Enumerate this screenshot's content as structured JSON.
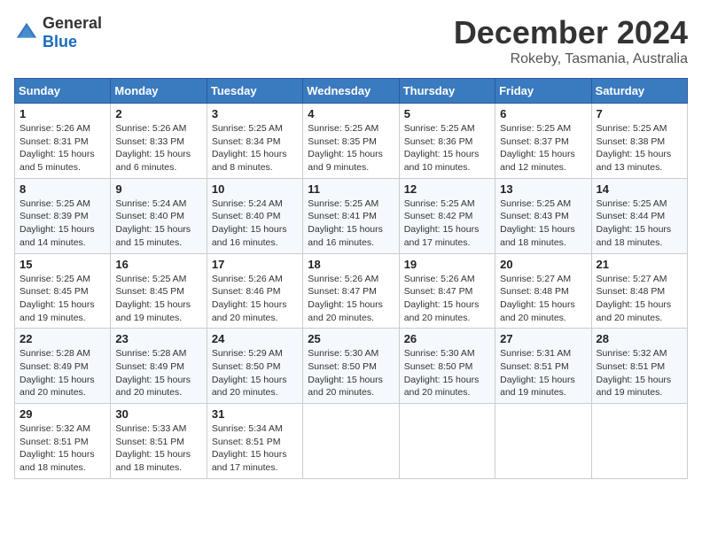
{
  "logo": {
    "general": "General",
    "blue": "Blue"
  },
  "title": {
    "month": "December 2024",
    "location": "Rokeby, Tasmania, Australia"
  },
  "calendar": {
    "headers": [
      "Sunday",
      "Monday",
      "Tuesday",
      "Wednesday",
      "Thursday",
      "Friday",
      "Saturday"
    ],
    "weeks": [
      [
        {
          "day": "1",
          "sunrise": "5:26 AM",
          "sunset": "8:31 PM",
          "daylight": "15 hours and 5 minutes."
        },
        {
          "day": "2",
          "sunrise": "5:26 AM",
          "sunset": "8:33 PM",
          "daylight": "15 hours and 6 minutes."
        },
        {
          "day": "3",
          "sunrise": "5:25 AM",
          "sunset": "8:34 PM",
          "daylight": "15 hours and 8 minutes."
        },
        {
          "day": "4",
          "sunrise": "5:25 AM",
          "sunset": "8:35 PM",
          "daylight": "15 hours and 9 minutes."
        },
        {
          "day": "5",
          "sunrise": "5:25 AM",
          "sunset": "8:36 PM",
          "daylight": "15 hours and 10 minutes."
        },
        {
          "day": "6",
          "sunrise": "5:25 AM",
          "sunset": "8:37 PM",
          "daylight": "15 hours and 12 minutes."
        },
        {
          "day": "7",
          "sunrise": "5:25 AM",
          "sunset": "8:38 PM",
          "daylight": "15 hours and 13 minutes."
        }
      ],
      [
        {
          "day": "8",
          "sunrise": "5:25 AM",
          "sunset": "8:39 PM",
          "daylight": "15 hours and 14 minutes."
        },
        {
          "day": "9",
          "sunrise": "5:24 AM",
          "sunset": "8:40 PM",
          "daylight": "15 hours and 15 minutes."
        },
        {
          "day": "10",
          "sunrise": "5:24 AM",
          "sunset": "8:40 PM",
          "daylight": "15 hours and 16 minutes."
        },
        {
          "day": "11",
          "sunrise": "5:25 AM",
          "sunset": "8:41 PM",
          "daylight": "15 hours and 16 minutes."
        },
        {
          "day": "12",
          "sunrise": "5:25 AM",
          "sunset": "8:42 PM",
          "daylight": "15 hours and 17 minutes."
        },
        {
          "day": "13",
          "sunrise": "5:25 AM",
          "sunset": "8:43 PM",
          "daylight": "15 hours and 18 minutes."
        },
        {
          "day": "14",
          "sunrise": "5:25 AM",
          "sunset": "8:44 PM",
          "daylight": "15 hours and 18 minutes."
        }
      ],
      [
        {
          "day": "15",
          "sunrise": "5:25 AM",
          "sunset": "8:45 PM",
          "daylight": "15 hours and 19 minutes."
        },
        {
          "day": "16",
          "sunrise": "5:25 AM",
          "sunset": "8:45 PM",
          "daylight": "15 hours and 19 minutes."
        },
        {
          "day": "17",
          "sunrise": "5:26 AM",
          "sunset": "8:46 PM",
          "daylight": "15 hours and 20 minutes."
        },
        {
          "day": "18",
          "sunrise": "5:26 AM",
          "sunset": "8:47 PM",
          "daylight": "15 hours and 20 minutes."
        },
        {
          "day": "19",
          "sunrise": "5:26 AM",
          "sunset": "8:47 PM",
          "daylight": "15 hours and 20 minutes."
        },
        {
          "day": "20",
          "sunrise": "5:27 AM",
          "sunset": "8:48 PM",
          "daylight": "15 hours and 20 minutes."
        },
        {
          "day": "21",
          "sunrise": "5:27 AM",
          "sunset": "8:48 PM",
          "daylight": "15 hours and 20 minutes."
        }
      ],
      [
        {
          "day": "22",
          "sunrise": "5:28 AM",
          "sunset": "8:49 PM",
          "daylight": "15 hours and 20 minutes."
        },
        {
          "day": "23",
          "sunrise": "5:28 AM",
          "sunset": "8:49 PM",
          "daylight": "15 hours and 20 minutes."
        },
        {
          "day": "24",
          "sunrise": "5:29 AM",
          "sunset": "8:50 PM",
          "daylight": "15 hours and 20 minutes."
        },
        {
          "day": "25",
          "sunrise": "5:30 AM",
          "sunset": "8:50 PM",
          "daylight": "15 hours and 20 minutes."
        },
        {
          "day": "26",
          "sunrise": "5:30 AM",
          "sunset": "8:50 PM",
          "daylight": "15 hours and 20 minutes."
        },
        {
          "day": "27",
          "sunrise": "5:31 AM",
          "sunset": "8:51 PM",
          "daylight": "15 hours and 19 minutes."
        },
        {
          "day": "28",
          "sunrise": "5:32 AM",
          "sunset": "8:51 PM",
          "daylight": "15 hours and 19 minutes."
        }
      ],
      [
        {
          "day": "29",
          "sunrise": "5:32 AM",
          "sunset": "8:51 PM",
          "daylight": "15 hours and 18 minutes."
        },
        {
          "day": "30",
          "sunrise": "5:33 AM",
          "sunset": "8:51 PM",
          "daylight": "15 hours and 18 minutes."
        },
        {
          "day": "31",
          "sunrise": "5:34 AM",
          "sunset": "8:51 PM",
          "daylight": "15 hours and 17 minutes."
        },
        null,
        null,
        null,
        null
      ]
    ]
  },
  "labels": {
    "sunrise": "Sunrise:",
    "sunset": "Sunset:",
    "daylight": "Daylight:"
  }
}
